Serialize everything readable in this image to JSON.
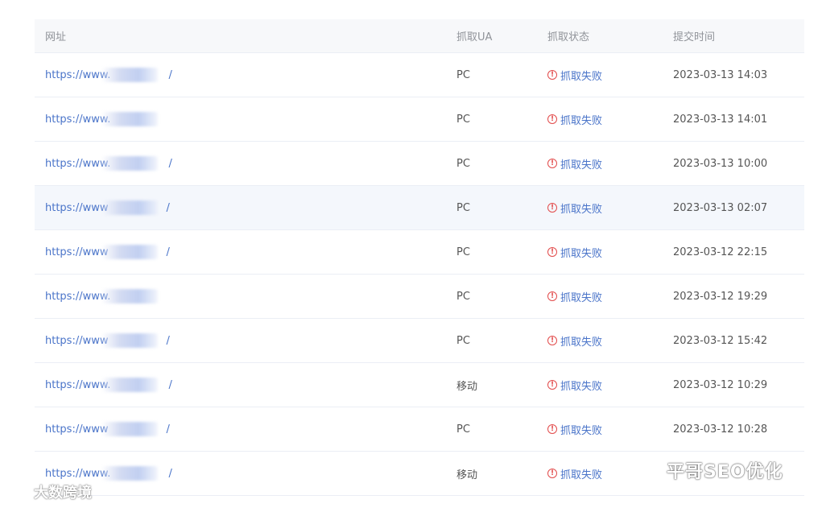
{
  "table": {
    "headers": {
      "url": "网址",
      "ua": "抓取UA",
      "status": "抓取状态",
      "time": "提交时间"
    },
    "rows": [
      {
        "url": "https://www.",
        "url_suffix": "/",
        "ua": "PC",
        "status": "抓取失败",
        "time": "2023-03-13 14:03"
      },
      {
        "url": "https://www.",
        "url_suffix": "",
        "ua": "PC",
        "status": "抓取失败",
        "time": "2023-03-13 14:01"
      },
      {
        "url": "https://www.",
        "url_suffix": "/",
        "ua": "PC",
        "status": "抓取失败",
        "time": "2023-03-13 10:00"
      },
      {
        "url": "https://www",
        "url_suffix": "/",
        "ua": "PC",
        "status": "抓取失败",
        "time": "2023-03-13 02:07"
      },
      {
        "url": "https://www",
        "url_suffix": "/",
        "ua": "PC",
        "status": "抓取失败",
        "time": "2023-03-12 22:15"
      },
      {
        "url": "https://www.",
        "url_suffix": "",
        "ua": "PC",
        "status": "抓取失败",
        "time": "2023-03-12 19:29"
      },
      {
        "url": "https://www",
        "url_suffix": "/",
        "ua": "PC",
        "status": "抓取失败",
        "time": "2023-03-12 15:42"
      },
      {
        "url": "https://www.",
        "url_suffix": "/",
        "ua": "移动",
        "status": "抓取失败",
        "time": "2023-03-12 10:29"
      },
      {
        "url": "https://www",
        "url_suffix": "/",
        "ua": "PC",
        "status": "抓取失败",
        "time": "2023-03-12 10:28"
      },
      {
        "url": "https://www.",
        "url_suffix": "/",
        "ua": "移动",
        "status": "抓取失败",
        "time": ""
      }
    ]
  },
  "watermarks": {
    "left": "大数跨境",
    "right": "平哥SEO优化"
  },
  "colors": {
    "link": "#4a74c9",
    "error": "#e24b4b",
    "header_bg": "#f7f8fa",
    "hover_row_bg": "#f4f7fc"
  },
  "icons": {
    "status": "warning-circle-icon"
  }
}
